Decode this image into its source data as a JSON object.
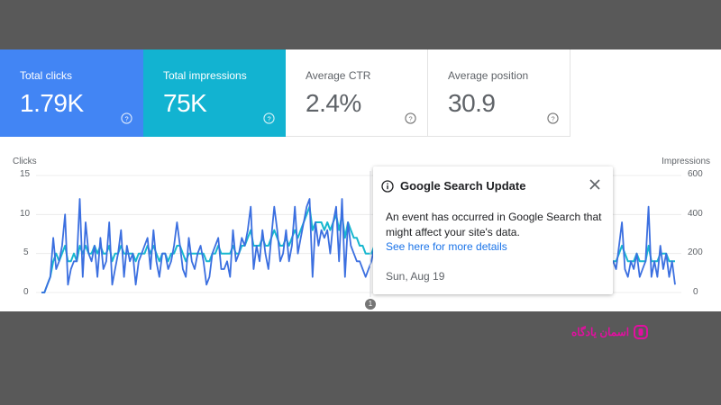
{
  "cards": [
    {
      "label": "Total clicks",
      "value": "1.79K"
    },
    {
      "label": "Total impressions",
      "value": "75K"
    },
    {
      "label": "Average CTR",
      "value": "2.4%"
    },
    {
      "label": "Average position",
      "value": "30.9"
    }
  ],
  "chart_data": {
    "type": "line",
    "left_axis": {
      "label": "Clicks",
      "ticks": [
        "15",
        "10",
        "5",
        "0"
      ],
      "range": [
        0,
        15
      ]
    },
    "right_axis": {
      "label": "Impressions",
      "ticks": [
        "600",
        "400",
        "200",
        "0"
      ],
      "range": [
        0,
        600
      ]
    },
    "series": [
      {
        "values": [
          0,
          0,
          1,
          2,
          7,
          3,
          4,
          6,
          10,
          1,
          3,
          4,
          4,
          12,
          2,
          9,
          5,
          4,
          6,
          2,
          7,
          3,
          4,
          9,
          1,
          3,
          5,
          8,
          2,
          6,
          4,
          5,
          1,
          4,
          5,
          6,
          7,
          3,
          8,
          4,
          2,
          5,
          5,
          3,
          4,
          6,
          9,
          6,
          3,
          2,
          7,
          4,
          3,
          5,
          6,
          4,
          1,
          2,
          5,
          6,
          7,
          3,
          3,
          4,
          2,
          8,
          4,
          5,
          7,
          6,
          8,
          11,
          3,
          6,
          4,
          8,
          5,
          3,
          7,
          11,
          8,
          4,
          5,
          8,
          4,
          6,
          11,
          5,
          7,
          9,
          11,
          12,
          2,
          9,
          6,
          8,
          7,
          8,
          5,
          9,
          11,
          4,
          12,
          2,
          9,
          6,
          5,
          4,
          4,
          3,
          2,
          3,
          4,
          6,
          5,
          7,
          3,
          5,
          5,
          7,
          3,
          8,
          4,
          5,
          5,
          3,
          6,
          4,
          3,
          7,
          9,
          3,
          2,
          5,
          3,
          4,
          2,
          4,
          5,
          6,
          3,
          7,
          3,
          4,
          5,
          3,
          6,
          3,
          5,
          4,
          3,
          4,
          2,
          5,
          3,
          4,
          5,
          7,
          5,
          8,
          5,
          6,
          4,
          5,
          2,
          3,
          3,
          4,
          3,
          1,
          2,
          3,
          2,
          4,
          2,
          5,
          2,
          4,
          2,
          3,
          2,
          2,
          3,
          3,
          6,
          2,
          1,
          4,
          8,
          2,
          4,
          3,
          5,
          4,
          4,
          3,
          6,
          9,
          3,
          2,
          4,
          3,
          5,
          2,
          3,
          4,
          11,
          2,
          4,
          2,
          6,
          3,
          5,
          2,
          4,
          1
        ]
      },
      {
        "values": [
          0,
          0,
          1,
          2,
          4,
          5,
          4,
          5,
          6,
          4,
          4,
          5,
          4,
          6,
          5,
          6,
          5,
          5,
          6,
          5,
          6,
          5,
          5,
          6,
          4,
          5,
          5,
          6,
          5,
          5,
          5,
          5,
          4,
          5,
          5,
          5,
          6,
          5,
          6,
          5,
          4,
          5,
          5,
          4,
          5,
          5,
          6,
          6,
          5,
          4,
          5,
          5,
          5,
          5,
          5,
          5,
          4,
          4,
          5,
          5,
          6,
          5,
          5,
          5,
          5,
          6,
          5,
          5,
          6,
          6,
          7,
          8,
          6,
          6,
          6,
          7,
          6,
          6,
          7,
          8,
          7,
          6,
          6,
          7,
          6,
          7,
          8,
          7,
          8,
          9,
          10,
          11,
          8,
          9,
          9,
          9,
          8,
          9,
          8,
          9,
          10,
          8,
          10,
          7,
          9,
          8,
          7,
          7,
          6,
          6,
          5,
          5,
          5,
          6,
          6,
          6,
          5,
          5,
          5,
          6,
          5,
          6,
          5,
          5,
          5,
          5,
          5,
          5,
          5,
          6,
          6,
          5,
          4,
          5,
          5,
          5,
          4,
          5,
          5,
          5,
          5,
          5,
          5,
          5,
          5,
          5,
          5,
          5,
          5,
          5,
          5,
          5,
          4,
          5,
          5,
          5,
          5,
          6,
          6,
          6,
          5,
          5,
          5,
          5,
          4,
          4,
          4,
          4,
          4,
          3,
          3,
          3,
          3,
          4,
          4,
          4,
          4,
          4,
          4,
          4,
          4,
          4,
          4,
          4,
          5,
          4,
          3,
          4,
          5,
          4,
          4,
          4,
          5,
          4,
          4,
          4,
          5,
          6,
          5,
          4,
          4,
          4,
          5,
          4,
          4,
          4,
          6,
          4,
          4,
          4,
          5,
          5,
          5,
          4,
          4,
          4
        ]
      }
    ]
  },
  "tooltip": {
    "title": "Google Search Update",
    "body": "An event has occurred in Google Search that might affect your site's data.",
    "link": "See here for more details",
    "date": "Sun, Aug 19",
    "marker": "1"
  },
  "watermark": {
    "text": "اسمان یادگاه"
  },
  "colors": {
    "clicks": "#4285f4",
    "impressions": "#12b3d1",
    "clicks_line": "#3b6fe0",
    "impressions_line": "#17b7cf"
  },
  "icons": {
    "help": "question-circle-icon",
    "info": "info-icon",
    "close": "close-icon"
  }
}
